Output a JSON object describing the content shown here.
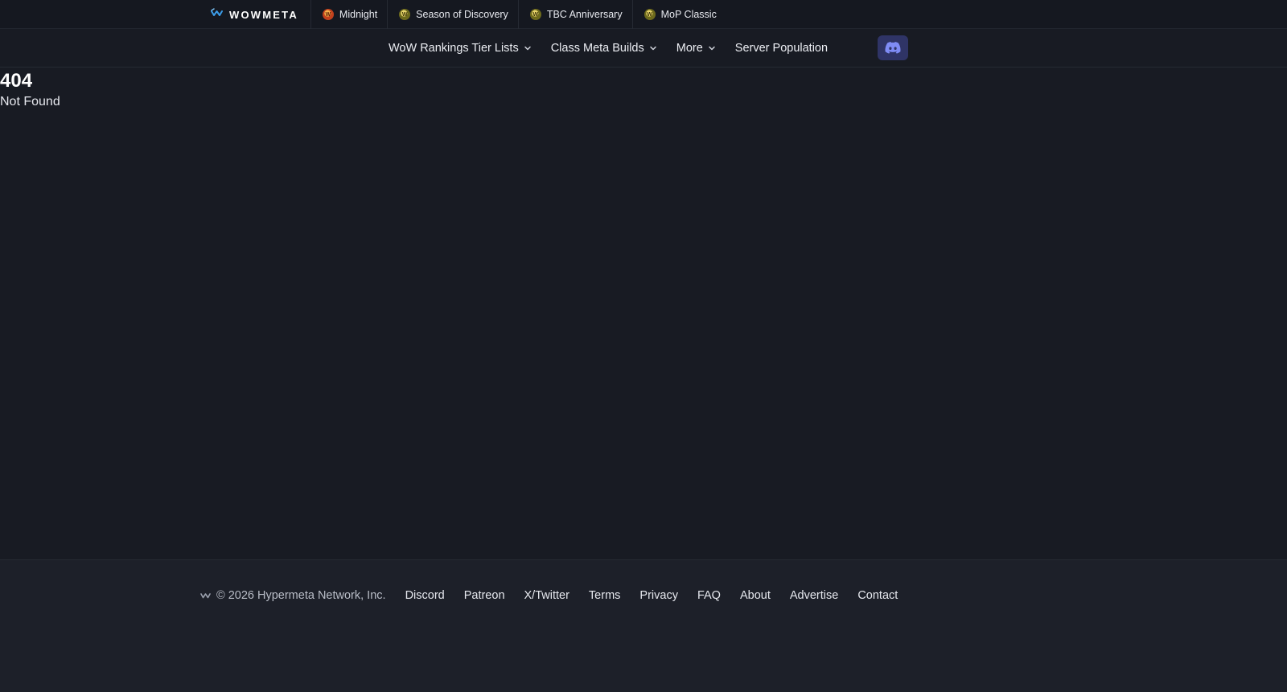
{
  "topbar": {
    "brand": "WOWMETA",
    "games": [
      {
        "label": "Midnight",
        "icon": "midnight-game-icon"
      },
      {
        "label": "Season of Discovery",
        "icon": "sod-game-icon"
      },
      {
        "label": "TBC Anniversary",
        "icon": "tbc-game-icon"
      },
      {
        "label": "MoP Classic",
        "icon": "mop-game-icon"
      }
    ]
  },
  "nav": {
    "items": [
      {
        "label": "WoW Rankings Tier Lists",
        "dropdown": true
      },
      {
        "label": "Class Meta Builds",
        "dropdown": true
      },
      {
        "label": "More",
        "dropdown": true
      },
      {
        "label": "Server Population",
        "dropdown": false
      }
    ],
    "discord_icon": "discord-icon"
  },
  "error": {
    "code": "404",
    "message": "Not Found"
  },
  "footer": {
    "copyright": "© 2026 Hypermeta Network, Inc.",
    "links": [
      "Discord",
      "Patreon",
      "X/Twitter",
      "Terms",
      "Privacy",
      "FAQ",
      "About",
      "Advertise",
      "Contact"
    ]
  },
  "colors": {
    "background": "#181b23",
    "topbar": "#151820",
    "footer": "#1d2029",
    "discord_button": "#2f3466",
    "brand_accent": "#3b9ce8"
  }
}
